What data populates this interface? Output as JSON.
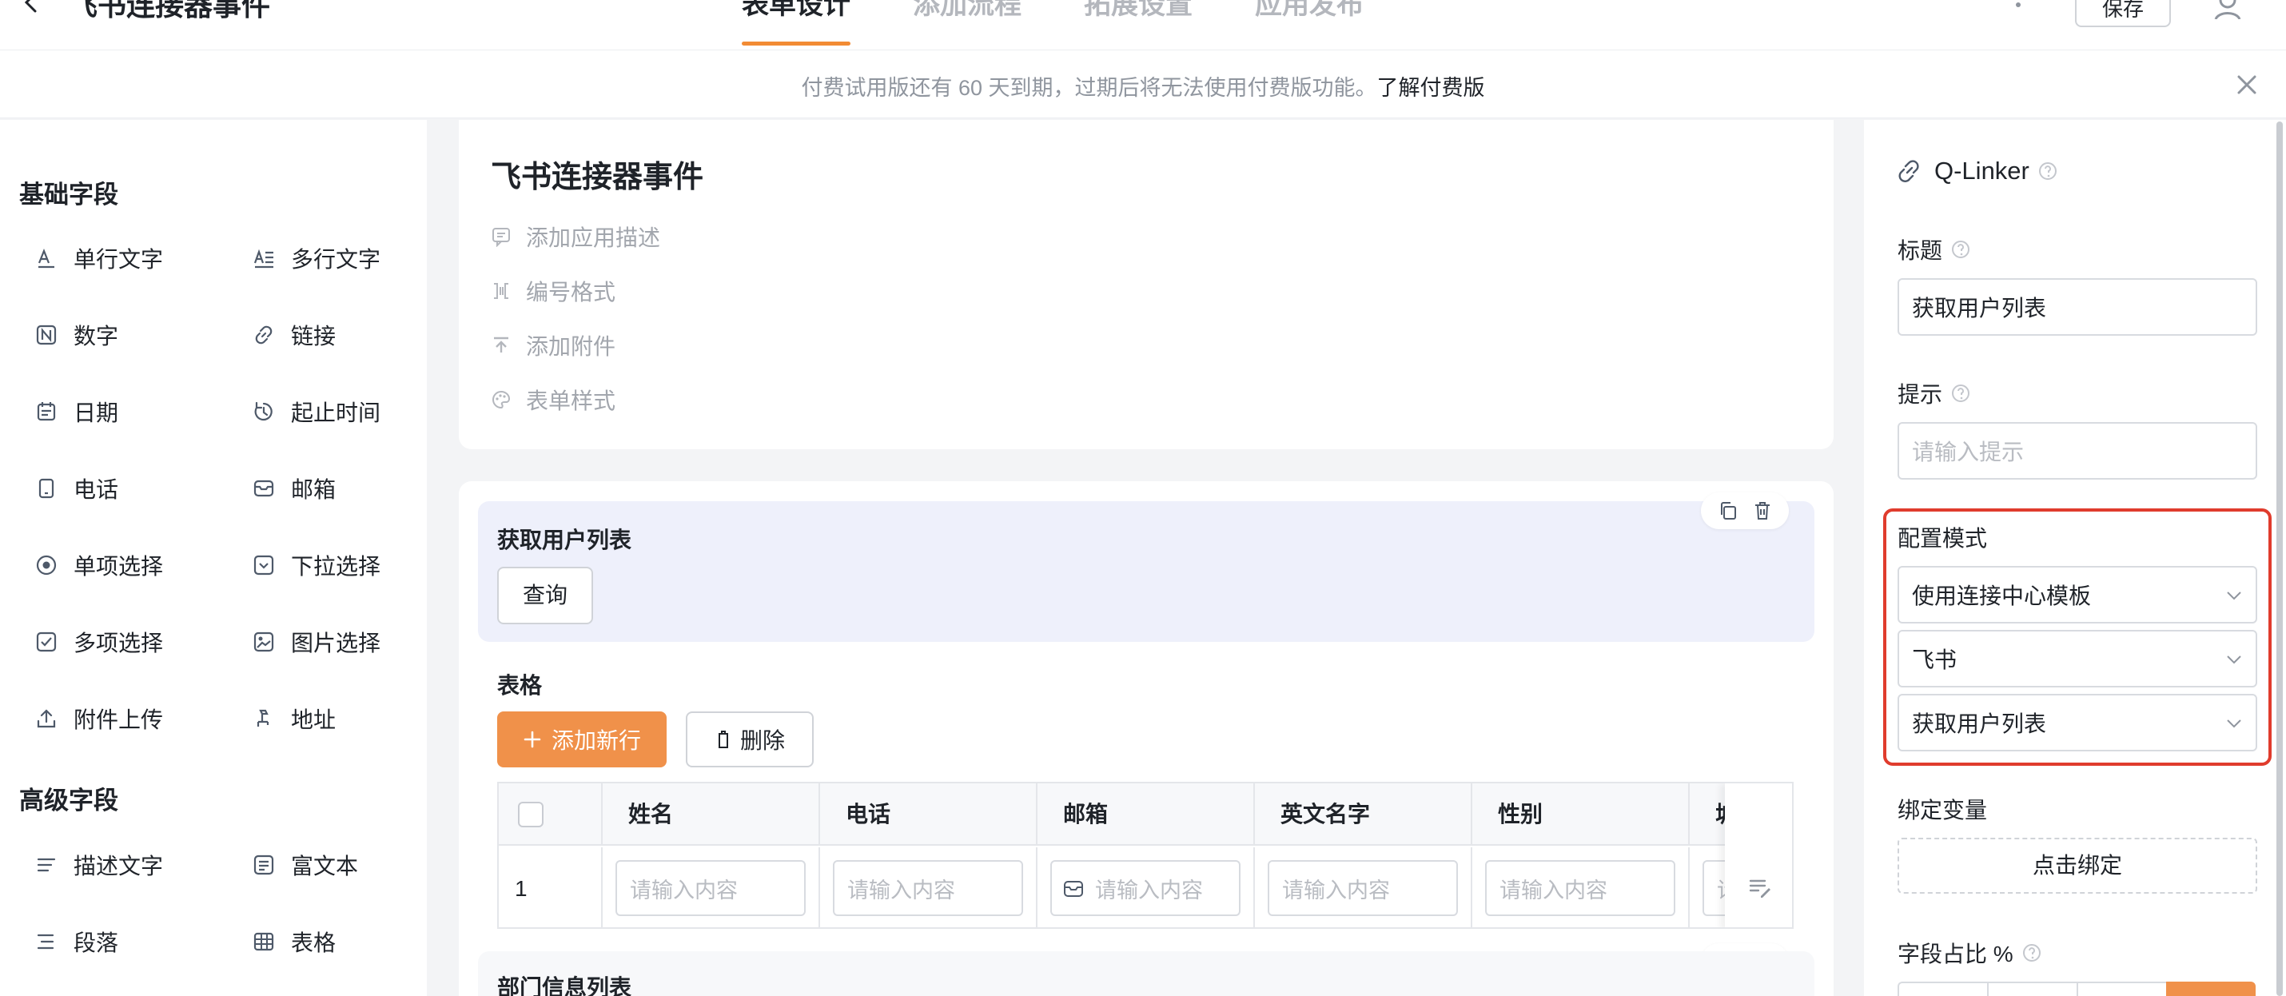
{
  "header": {
    "app_title": "飞书连接器事件",
    "tabs": [
      {
        "label": "表单设计",
        "active": true
      },
      {
        "label": "添加流程",
        "active": false
      },
      {
        "label": "拓展设置",
        "active": false
      },
      {
        "label": "应用发布",
        "active": false
      }
    ],
    "save_label": "保存"
  },
  "notice": {
    "text": "付费试用版还有 60 天到期，过期后将无法使用付费版功能。",
    "link": "了解付费版"
  },
  "left_panel": {
    "basic_title": "基础字段",
    "basic_fields": [
      {
        "label": "单行文字",
        "icon": "single-line-text-icon"
      },
      {
        "label": "多行文字",
        "icon": "multi-line-text-icon"
      },
      {
        "label": "数字",
        "icon": "number-icon"
      },
      {
        "label": "链接",
        "icon": "link-icon"
      },
      {
        "label": "日期",
        "icon": "calendar-icon"
      },
      {
        "label": "起止时间",
        "icon": "time-range-icon"
      },
      {
        "label": "电话",
        "icon": "phone-icon"
      },
      {
        "label": "邮箱",
        "icon": "mail-icon"
      },
      {
        "label": "单项选择",
        "icon": "radio-icon"
      },
      {
        "label": "下拉选择",
        "icon": "dropdown-icon"
      },
      {
        "label": "多项选择",
        "icon": "checkbox-icon"
      },
      {
        "label": "图片选择",
        "icon": "image-icon"
      },
      {
        "label": "附件上传",
        "icon": "upload-icon"
      },
      {
        "label": "地址",
        "icon": "location-icon"
      }
    ],
    "advanced_title": "高级字段",
    "advanced_fields": [
      {
        "label": "描述文字",
        "icon": "description-icon"
      },
      {
        "label": "富文本",
        "icon": "rich-text-icon"
      },
      {
        "label": "段落",
        "icon": "paragraph-icon"
      },
      {
        "label": "表格",
        "icon": "table-icon"
      }
    ]
  },
  "canvas": {
    "form_title": "飞书连接器事件",
    "meta": [
      {
        "label": "添加应用描述",
        "icon": "comment-icon"
      },
      {
        "label": "编号格式",
        "icon": "numbering-icon"
      },
      {
        "label": "添加附件",
        "icon": "upload-icon"
      },
      {
        "label": "表单样式",
        "icon": "palette-icon"
      }
    ],
    "linker_block": {
      "label": "获取用户列表",
      "button": "查询"
    },
    "table_block": {
      "label": "表格",
      "add_row": "添加新行",
      "delete": "删除",
      "columns": [
        "姓名",
        "电话",
        "邮箱",
        "英文名字",
        "性别",
        "城"
      ],
      "rows": [
        {
          "index": "1",
          "placeholder": "请输入内容"
        }
      ]
    },
    "next_block": {
      "label": "部门信息列表"
    }
  },
  "right_panel": {
    "component_name": "Q-Linker",
    "title_label": "标题",
    "title_value": "获取用户列表",
    "hint_label": "提示",
    "hint_placeholder": "请输入提示",
    "config_label": "配置模式",
    "config_mode": "使用连接中心模板",
    "connector": "飞书",
    "action": "获取用户列表",
    "bind_label": "绑定变量",
    "bind_button": "点击绑定",
    "ratio_label": "字段占比 %"
  },
  "colors": {
    "accent": "#f0914a",
    "highlight_border": "#e03c2d",
    "selected_block_bg": "#eef0fb"
  }
}
